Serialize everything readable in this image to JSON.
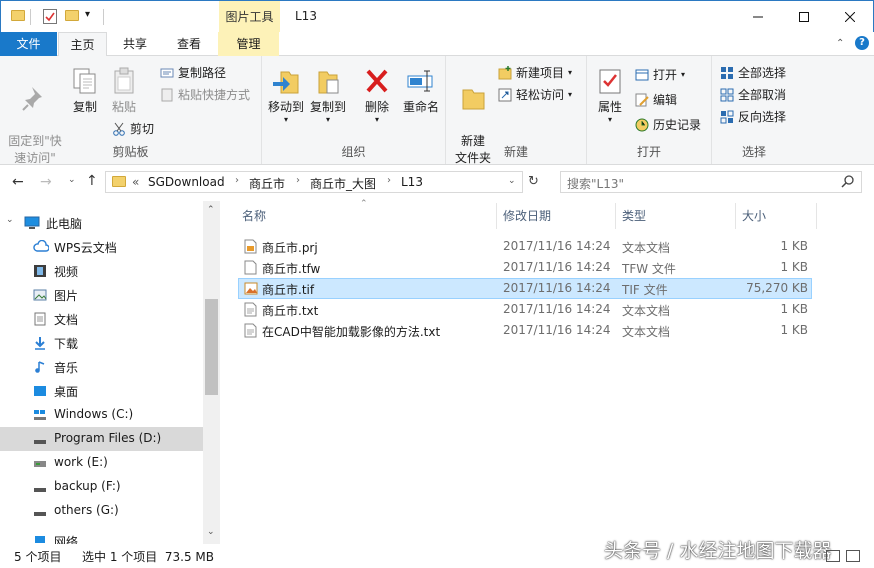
{
  "window": {
    "title": "L13",
    "context_tab": "图片工具"
  },
  "ribbon_tabs": [
    "文件",
    "主页",
    "共享",
    "查看",
    "管理"
  ],
  "ribbon": {
    "clipboard": {
      "label": "剪贴板",
      "pin": "固定到\"快\n速访问\"",
      "copy": "复制",
      "paste": "粘贴",
      "copy_path": "复制路径",
      "paste_shortcut": "粘贴快捷方式",
      "cut": "剪切"
    },
    "organize": {
      "label": "组织",
      "move_to": "移动到",
      "copy_to": "复制到",
      "delete": "删除",
      "rename": "重命名"
    },
    "new": {
      "label": "新建",
      "new_folder": "新建\n文件夹",
      "new_item": "新建项目",
      "easy_access": "轻松访问"
    },
    "open": {
      "label": "打开",
      "properties": "属性",
      "open": "打开",
      "edit": "编辑",
      "history": "历史记录"
    },
    "select": {
      "label": "选择",
      "select_all": "全部选择",
      "select_none": "全部取消",
      "invert": "反向选择"
    }
  },
  "address": {
    "overflow": "«",
    "crumbs": [
      "SGDownload",
      "商丘市",
      "商丘市_大图",
      "L13"
    ],
    "search_placeholder": "搜索\"L13\""
  },
  "nav": {
    "items": [
      "此电脑",
      "WPS云文档",
      "视频",
      "图片",
      "文档",
      "下载",
      "音乐",
      "桌面",
      "Windows (C:)",
      "Program Files (D:)",
      "work (E:)",
      "backup (F:)",
      "others (G:)",
      "网络"
    ]
  },
  "columns": {
    "name": "名称",
    "date": "修改日期",
    "type": "类型",
    "size": "大小"
  },
  "files": [
    {
      "name": "商丘市.prj",
      "date": "2017/11/16 14:24",
      "type": "文本文档",
      "size": "1 KB"
    },
    {
      "name": "商丘市.tfw",
      "date": "2017/11/16 14:24",
      "type": "TFW 文件",
      "size": "1 KB"
    },
    {
      "name": "商丘市.tif",
      "date": "2017/11/16 14:24",
      "type": "TIF 文件",
      "size": "75,270 KB"
    },
    {
      "name": "商丘市.txt",
      "date": "2017/11/16 14:24",
      "type": "文本文档",
      "size": "1 KB"
    },
    {
      "name": "在CAD中智能加载影像的方法.txt",
      "date": "2017/11/16 14:24",
      "type": "文本文档",
      "size": "1 KB"
    }
  ],
  "status": {
    "count": "5 个项目",
    "selection": "选中 1 个项目  73.5 MB"
  },
  "watermark": "头条号 / 水经注地图下载器",
  "colors": {
    "accent": "#1979ca",
    "selected_row": "#cce8ff",
    "selected_border": "#99d1ff",
    "context_tab": "#fdf2b8"
  }
}
